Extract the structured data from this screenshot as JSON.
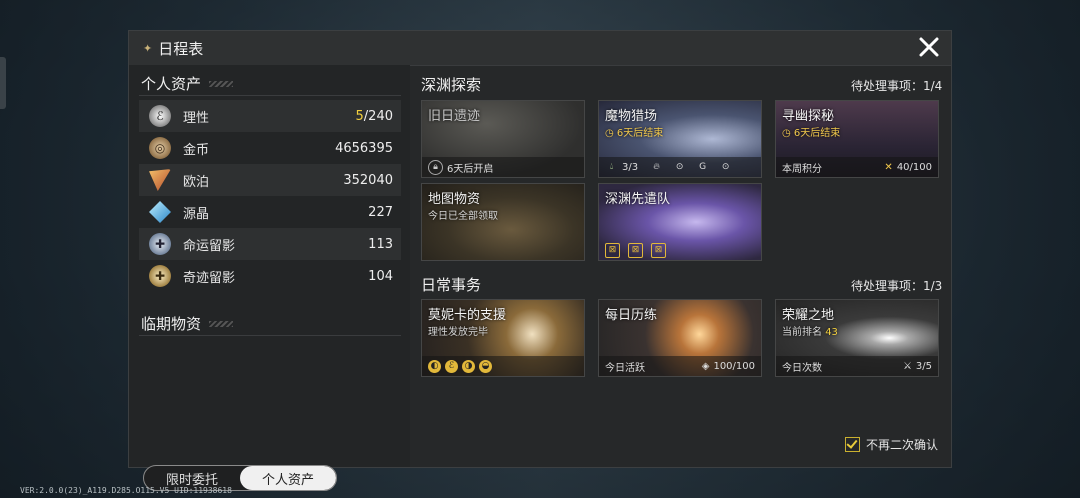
{
  "header": {
    "title": "日程表"
  },
  "left": {
    "assets_title": "个人资产",
    "assets": [
      {
        "label": "理性",
        "value_hl": "5",
        "value_rest": "/240",
        "icon": "sanity-icon",
        "color": "#cfcfcf"
      },
      {
        "label": "金币",
        "value": "4656395",
        "icon": "gold-coin-icon",
        "color": "#c9a77a"
      },
      {
        "label": "欧泊",
        "value": "352040",
        "icon": "opal-icon",
        "color": "#e89a3a"
      },
      {
        "label": "源晶",
        "value": "227",
        "icon": "crystal-icon",
        "color": "#5fc3e6"
      },
      {
        "label": "命运留影",
        "value": "113",
        "icon": "fate-image-icon",
        "color": "#b9c6d6"
      },
      {
        "label": "奇迹留影",
        "value": "104",
        "icon": "miracle-image-icon",
        "color": "#e0c98f"
      }
    ],
    "expiring_title": "临期物资",
    "toggle": {
      "a": "限时委托",
      "b": "个人资产"
    }
  },
  "abyss": {
    "title": "深渊探索",
    "pending": "待处理事项：1/4",
    "cards": [
      {
        "title": "旧日遗迹",
        "foot": "6天后开启"
      },
      {
        "title": "魔物猎场",
        "sub": "6天后结束",
        "foot_count": "3/3"
      },
      {
        "title": "寻幽探秘",
        "sub": "6天后结束",
        "foot": "本周积分",
        "foot_r": "40/100"
      },
      {
        "title": "地图物资",
        "sub": "今日已全部领取"
      },
      {
        "title": "深渊先遣队"
      }
    ]
  },
  "daily": {
    "title": "日常事务",
    "pending": "待处理事项：1/3",
    "cards": [
      {
        "title": "莫妮卡的支援",
        "sub": "理性发放完毕"
      },
      {
        "title": "每日历练",
        "foot": "今日活跃",
        "foot_r": "100/100"
      },
      {
        "title": "荣耀之地",
        "sub": "当前排名",
        "rank": "43",
        "foot": "今日次数",
        "foot_r": "3/5"
      }
    ]
  },
  "confirm_label": "不再二次确认",
  "version": "VER:2.0.0(23)_A119.D285.O115.V5   UID:11938618",
  "colors": {
    "accent_yellow": "#f2cf3e",
    "panel": "#262829"
  }
}
